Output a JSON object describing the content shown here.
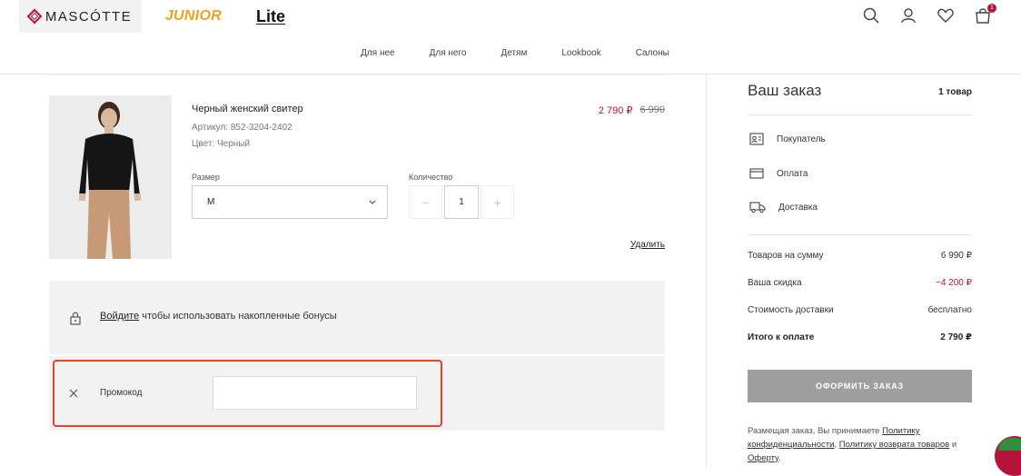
{
  "header": {
    "brands": [
      "MASCÓTTE",
      "JUNIOR",
      "Lite"
    ],
    "cart_count": "1"
  },
  "nav": [
    "Для нее",
    "Для него",
    "Детям",
    "Lookbook",
    "Салоны"
  ],
  "item": {
    "name": "Черный женский свитер",
    "article": "Артикул: 852-3204-2402",
    "color": "Цвет: Черный",
    "price_new": "2 790 ₽",
    "price_old": "6 990",
    "size_label": "Размер",
    "size_value": "M",
    "qty_label": "Количество",
    "qty_value": "1",
    "qty_minus": "−",
    "qty_plus": "+",
    "delete": "Удалить"
  },
  "bonus": {
    "login": "Войдите",
    "text": " чтобы использовать накопленные бонусы"
  },
  "promo": {
    "label": "Промокод",
    "value": "",
    "placeholder": ""
  },
  "order": {
    "title": "Ваш заказ",
    "count": "1 товар",
    "steps": [
      "Покупатель",
      "Оплата",
      "Доставка"
    ],
    "summary": [
      {
        "label": "Товаров на сумму",
        "value": "6 990 ₽"
      },
      {
        "label": "Ваша скидка",
        "value": "−4 200 ₽"
      },
      {
        "label": "Стоимость доставки",
        "value": "бесплатно"
      },
      {
        "label": "Итого к оплате",
        "value": "2 790 ₽"
      }
    ],
    "checkout": "ОФОРМИТЬ ЗАКАЗ",
    "legal": {
      "prefix": "Размещая заказ, Вы принимаете ",
      "link1": "Политику конфиденциальности",
      "sep": ", ",
      "link2": "Политику возврата товаров",
      "and": " и ",
      "link3": "Оферту",
      "end": "."
    }
  },
  "colors": {
    "accent": "#b3143b",
    "highlight": "#e4412f",
    "button": "#9e9e9e",
    "panel": "#f2f2f2"
  }
}
